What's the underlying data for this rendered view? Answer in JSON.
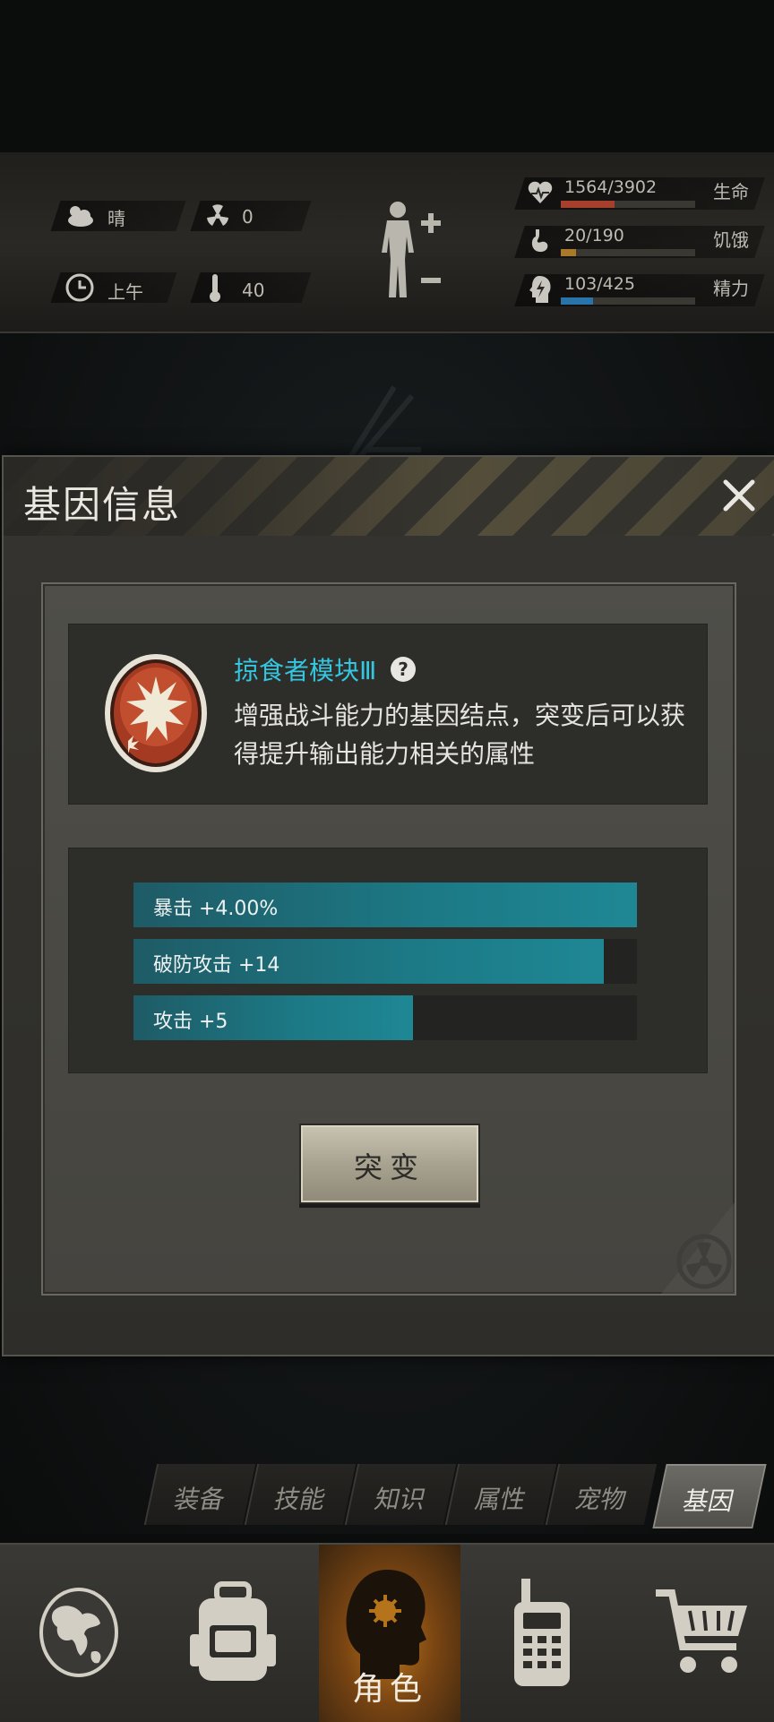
{
  "status": {
    "weather": "晴",
    "radiation": "0",
    "time_of_day": "上午",
    "temperature": "40",
    "life": {
      "value": "1564/3902",
      "label": "生命",
      "ratio": 0.4,
      "color": "#a6402c"
    },
    "hunger": {
      "value": "20/190",
      "label": "饥饿",
      "ratio": 0.11,
      "color": "#a97a2a"
    },
    "energy": {
      "value": "103/425",
      "label": "精力",
      "ratio": 0.24,
      "color": "#2a73a8"
    }
  },
  "dialog": {
    "title": "基因信息",
    "gene_name": "掠食者模块Ⅲ",
    "gene_description": "增强战斗能力的基因结点，突变后可以获得提升输出能力相关的属性",
    "stats": [
      {
        "label": "暴击 +4.00%",
        "ratio": 1.0
      },
      {
        "label": "破防攻击 +14",
        "ratio": 0.935
      },
      {
        "label": "攻击 +5",
        "ratio": 0.555
      }
    ],
    "mutate_button": "突变"
  },
  "tabs": [
    {
      "label": "装备",
      "active": false
    },
    {
      "label": "技能",
      "active": false
    },
    {
      "label": "知识",
      "active": false
    },
    {
      "label": "属性",
      "active": false
    },
    {
      "label": "宠物",
      "active": false
    },
    {
      "label": "基因",
      "active": true
    }
  ],
  "bottom_nav": {
    "active_label": "角色"
  }
}
